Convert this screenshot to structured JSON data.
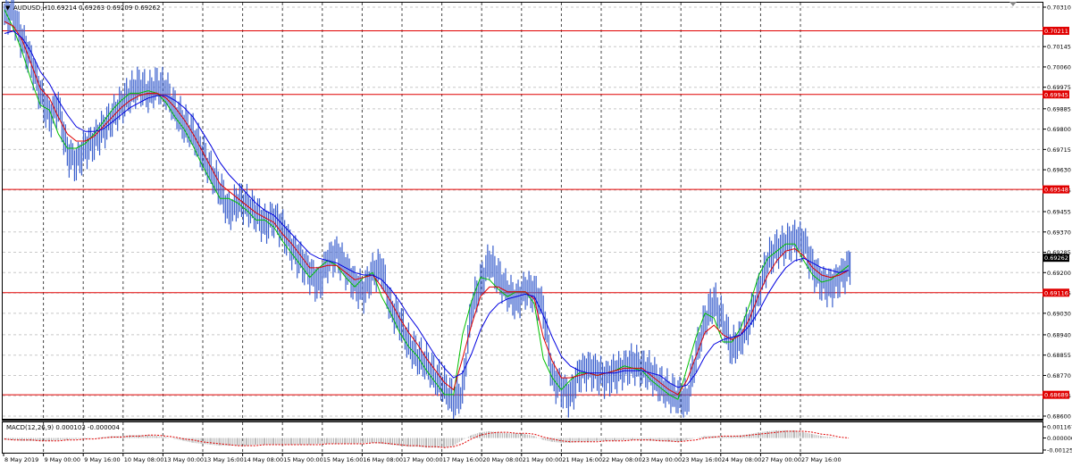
{
  "window": {
    "title": "AUDUSD,H1",
    "ohlc": "0.69214 0.69263 0.69209 0.69262",
    "menu_glyph": "▼"
  },
  "price_axis": {
    "ticks": [
      "0.70310",
      "0.70145",
      "0.70060",
      "0.69975",
      "0.69885",
      "0.69800",
      "0.69715",
      "0.69630",
      "0.69545",
      "0.69455",
      "0.69370",
      "0.69285",
      "0.69200",
      "0.69115",
      "0.69030",
      "0.68940",
      "0.68855",
      "0.68770",
      "0.68685",
      "0.68600"
    ],
    "min": 0.686,
    "max": 0.7031
  },
  "level_tags": [
    {
      "label": "0.70211",
      "value": 0.70211
    },
    {
      "label": "0.69945",
      "value": 0.69945
    },
    {
      "label": "0.69548",
      "value": 0.69548
    },
    {
      "label": "0.69262",
      "value": 0.69262,
      "current": true
    },
    {
      "label": "0.69116",
      "value": 0.69116
    },
    {
      "label": "0.68689",
      "value": 0.68689
    }
  ],
  "macd": {
    "label": "MACD(12,26,9) 0.000103 -0.000004",
    "ticks": [
      "0.001167",
      "0.000000",
      "-0.001255"
    ]
  },
  "time_axis": {
    "labels": [
      "8 May 2019",
      "9 May 00:00",
      "9 May 16:00",
      "10 May 08:00",
      "13 May 00:00",
      "13 May 16:00",
      "14 May 08:00",
      "15 May 00:00",
      "15 May 16:00",
      "16 May 08:00",
      "17 May 00:00",
      "17 May 16:00",
      "20 May 08:00",
      "21 May 00:00",
      "21 May 16:00",
      "22 May 08:00",
      "23 May 00:00",
      "23 May 16:00",
      "24 May 08:00",
      "27 May 00:00",
      "27 May 16:00"
    ]
  },
  "colors": {
    "price": "#3a5fcd",
    "ma_fast": "#00c000",
    "ma_mid": "#e00000",
    "ma_slow": "#0000e0",
    "level": "#e00000",
    "tag_bg": "#e00000",
    "current_bg": "#000000",
    "macd_hist": "#b0b0b0",
    "macd_signal": "#e00000"
  },
  "chart_data": {
    "type": "line",
    "symbol": "AUDUSD",
    "timeframe": "H1",
    "x": [
      0,
      10,
      20,
      30,
      40,
      50,
      60,
      70,
      80,
      90,
      100,
      110,
      120,
      130,
      140,
      150,
      160,
      170,
      180,
      190,
      200,
      210,
      220,
      230,
      240,
      250,
      260,
      270,
      280,
      290,
      300,
      310,
      320,
      330,
      340,
      350,
      360,
      370,
      380,
      390,
      400,
      410,
      420,
      430,
      440,
      450,
      460,
      470,
      480,
      490,
      500,
      510,
      520,
      530,
      540,
      550,
      560,
      570,
      580,
      590,
      600,
      610,
      620,
      630,
      640,
      650,
      660,
      670,
      680,
      690,
      700,
      710,
      720,
      730,
      740,
      750,
      760,
      770,
      780,
      790,
      800,
      810,
      820,
      830,
      840,
      850,
      860,
      870,
      880,
      890,
      900,
      910,
      920,
      930,
      940
    ],
    "series": [
      {
        "values": [
          0.7028,
          0.7017,
          0.7008,
          0.6995,
          0.6985,
          0.699,
          0.697,
          0.6966,
          0.6972,
          0.6975,
          0.698,
          0.6985,
          0.699,
          0.6995,
          0.6998,
          0.6995,
          0.6998,
          0.6996,
          0.6988,
          0.6982,
          0.6978,
          0.697,
          0.6962,
          0.6955,
          0.6945,
          0.695,
          0.6948,
          0.6945,
          0.694,
          0.6943,
          0.6938,
          0.693,
          0.6925,
          0.692,
          0.6915,
          0.6925,
          0.6928,
          0.6922,
          0.6915,
          0.6912,
          0.692,
          0.6922,
          0.6905,
          0.69,
          0.689,
          0.6885,
          0.6882,
          0.6876,
          0.6872,
          0.6866,
          0.687,
          0.6905,
          0.6915,
          0.6925,
          0.6918,
          0.6912,
          0.6908,
          0.6913,
          0.6912,
          0.6905,
          0.6876,
          0.6872,
          0.6868,
          0.6878,
          0.688,
          0.6878,
          0.6876,
          0.6878,
          0.688,
          0.6882,
          0.688,
          0.6878,
          0.6873,
          0.687,
          0.6868,
          0.6866,
          0.6885,
          0.69,
          0.6908,
          0.69,
          0.6888,
          0.6892,
          0.69,
          0.6912,
          0.6925,
          0.693,
          0.6932,
          0.6934,
          0.6933,
          0.6922,
          0.6916,
          0.6914,
          0.6918,
          0.6922,
          0.6926
        ]
      },
      {
        "values": [
          0.703,
          0.7022,
          0.7012,
          0.7,
          0.699,
          0.6988,
          0.6978,
          0.6972,
          0.6972,
          0.6974,
          0.6978,
          0.6983,
          0.6988,
          0.6992,
          0.6995,
          0.6995,
          0.6996,
          0.6995,
          0.6991,
          0.6985,
          0.698,
          0.6973,
          0.6965,
          0.6958,
          0.6951,
          0.6951,
          0.6949,
          0.6946,
          0.6942,
          0.6942,
          0.6939,
          0.6933,
          0.6928,
          0.6923,
          0.6918,
          0.6922,
          0.6925,
          0.6923,
          0.6918,
          0.6914,
          0.6918,
          0.692,
          0.691,
          0.6903,
          0.6895,
          0.6889,
          0.6885,
          0.6879,
          0.6874,
          0.6869,
          0.6869,
          0.6894,
          0.6908,
          0.6918,
          0.6917,
          0.6913,
          0.691,
          0.6912,
          0.6912,
          0.6907,
          0.6884,
          0.6876,
          0.6871,
          0.6875,
          0.6878,
          0.6878,
          0.6877,
          0.6878,
          0.6879,
          0.6881,
          0.688,
          0.6879,
          0.6875,
          0.6872,
          0.6869,
          0.6867,
          0.688,
          0.6893,
          0.6903,
          0.6901,
          0.6891,
          0.6891,
          0.6897,
          0.6907,
          0.6919,
          0.6926,
          0.6929,
          0.6932,
          0.6932,
          0.6925,
          0.6919,
          0.6916,
          0.6917,
          0.692,
          0.6923
        ]
      },
      {
        "values": [
          0.7025,
          0.7023,
          0.7017,
          0.7007,
          0.6997,
          0.6993,
          0.6985,
          0.6978,
          0.6975,
          0.6975,
          0.6977,
          0.6981,
          0.6985,
          0.6989,
          0.6992,
          0.6994,
          0.6995,
          0.6995,
          0.6993,
          0.6989,
          0.6984,
          0.6978,
          0.6971,
          0.6964,
          0.6957,
          0.6954,
          0.6951,
          0.6948,
          0.6945,
          0.6943,
          0.6941,
          0.6936,
          0.6932,
          0.6927,
          0.6922,
          0.6922,
          0.6923,
          0.6923,
          0.692,
          0.6917,
          0.6918,
          0.6919,
          0.6914,
          0.6908,
          0.6901,
          0.6895,
          0.689,
          0.6884,
          0.6879,
          0.6874,
          0.6871,
          0.6884,
          0.6898,
          0.691,
          0.6914,
          0.6914,
          0.6912,
          0.6912,
          0.6912,
          0.6909,
          0.6893,
          0.6883,
          0.6876,
          0.6876,
          0.6877,
          0.6878,
          0.6877,
          0.6878,
          0.6879,
          0.688,
          0.688,
          0.688,
          0.6877,
          0.6874,
          0.6871,
          0.6869,
          0.6875,
          0.6885,
          0.6895,
          0.6898,
          0.6894,
          0.6892,
          0.6894,
          0.6901,
          0.6911,
          0.6919,
          0.6925,
          0.6929,
          0.693,
          0.6927,
          0.6922,
          0.6919,
          0.6918,
          0.6919,
          0.6921
        ]
      },
      {
        "values": [
          0.702,
          0.7021,
          0.7018,
          0.7012,
          0.7004,
          0.6999,
          0.6992,
          0.6986,
          0.6981,
          0.6979,
          0.6979,
          0.698,
          0.6983,
          0.6986,
          0.6989,
          0.6991,
          0.6993,
          0.6994,
          0.6994,
          0.6992,
          0.6989,
          0.6985,
          0.6979,
          0.6973,
          0.6966,
          0.6961,
          0.6957,
          0.6953,
          0.6949,
          0.6946,
          0.6944,
          0.694,
          0.6936,
          0.6932,
          0.6928,
          0.6926,
          0.6925,
          0.6924,
          0.6922,
          0.692,
          0.6919,
          0.6919,
          0.6917,
          0.6913,
          0.6908,
          0.6902,
          0.6897,
          0.6891,
          0.6885,
          0.688,
          0.6876,
          0.6878,
          0.6886,
          0.6896,
          0.6903,
          0.6907,
          0.6909,
          0.691,
          0.6911,
          0.691,
          0.6902,
          0.6893,
          0.6885,
          0.6881,
          0.6879,
          0.6878,
          0.6878,
          0.6878,
          0.6878,
          0.6879,
          0.6879,
          0.6879,
          0.6878,
          0.6877,
          0.6874,
          0.6872,
          0.6873,
          0.6878,
          0.6885,
          0.689,
          0.6892,
          0.6893,
          0.6894,
          0.6898,
          0.6904,
          0.6911,
          0.6917,
          0.6922,
          0.6925,
          0.6926,
          0.6924,
          0.6922,
          0.6921,
          0.692,
          0.6921
        ]
      }
    ],
    "macd_histogram": [
      -0.0002,
      -0.0002,
      -0.0003,
      -0.0003,
      -0.0003,
      -0.0003,
      -0.0002,
      -0.0002,
      -0.0001,
      -0.0001,
      0.0,
      0.0001,
      0.0002,
      0.0002,
      0.0003,
      0.0003,
      0.0003,
      0.0002,
      0.0001,
      -0.0001,
      -0.0003,
      -0.0005,
      -0.0006,
      -0.0007,
      -0.0008,
      -0.0008,
      -0.0008,
      -0.0008,
      -0.0007,
      -0.0007,
      -0.0007,
      -0.0007,
      -0.0007,
      -0.0007,
      -0.0007,
      -0.0006,
      -0.0006,
      -0.0006,
      -0.0006,
      -0.0006,
      -0.0005,
      -0.0005,
      -0.0006,
      -0.0007,
      -0.0008,
      -0.0009,
      -0.0009,
      -0.001,
      -0.001,
      -0.001,
      -0.0008,
      -0.0002,
      0.0003,
      0.0006,
      0.0007,
      0.0006,
      0.0005,
      0.0005,
      0.0004,
      0.0002,
      -0.0002,
      -0.0004,
      -0.0005,
      -0.0005,
      -0.0004,
      -0.0004,
      -0.0003,
      -0.0003,
      -0.0003,
      -0.0002,
      -0.0002,
      -0.0002,
      -0.0003,
      -0.0003,
      -0.0004,
      -0.0004,
      -0.0002,
      0.0,
      0.0002,
      0.0002,
      0.0002,
      0.0002,
      0.0003,
      0.0004,
      0.0006,
      0.0007,
      0.0008,
      0.0008,
      0.0008,
      0.0006,
      0.0004,
      0.0002,
      0.0001,
      0.0,
      0.0
    ],
    "macd_signal": [
      -0.0001,
      -0.0002,
      -0.0002,
      -0.0002,
      -0.0003,
      -0.0003,
      -0.0003,
      -0.0002,
      -0.0002,
      -0.0001,
      -0.0001,
      0.0,
      0.0001,
      0.0001,
      0.0002,
      0.0002,
      0.0003,
      0.0003,
      0.0002,
      0.0001,
      -0.0001,
      -0.0002,
      -0.0004,
      -0.0005,
      -0.0006,
      -0.0007,
      -0.0008,
      -0.0008,
      -0.0008,
      -0.0007,
      -0.0007,
      -0.0007,
      -0.0007,
      -0.0007,
      -0.0007,
      -0.0007,
      -0.0006,
      -0.0006,
      -0.0006,
      -0.0006,
      -0.0006,
      -0.0005,
      -0.0005,
      -0.0006,
      -0.0007,
      -0.0008,
      -0.0008,
      -0.0009,
      -0.0009,
      -0.001,
      -0.0009,
      -0.0006,
      -0.0001,
      0.0003,
      0.0005,
      0.0006,
      0.0006,
      0.0005,
      0.0005,
      0.0004,
      0.0001,
      -0.0001,
      -0.0003,
      -0.0004,
      -0.0004,
      -0.0004,
      -0.0004,
      -0.0003,
      -0.0003,
      -0.0003,
      -0.0002,
      -0.0002,
      -0.0002,
      -0.0003,
      -0.0003,
      -0.0004,
      -0.0003,
      -0.0002,
      0.0,
      0.0001,
      0.0002,
      0.0002,
      0.0002,
      0.0003,
      0.0004,
      0.0005,
      0.0006,
      0.0007,
      0.0007,
      0.0007,
      0.0006,
      0.0004,
      0.0003,
      0.0001,
      0.0
    ]
  }
}
